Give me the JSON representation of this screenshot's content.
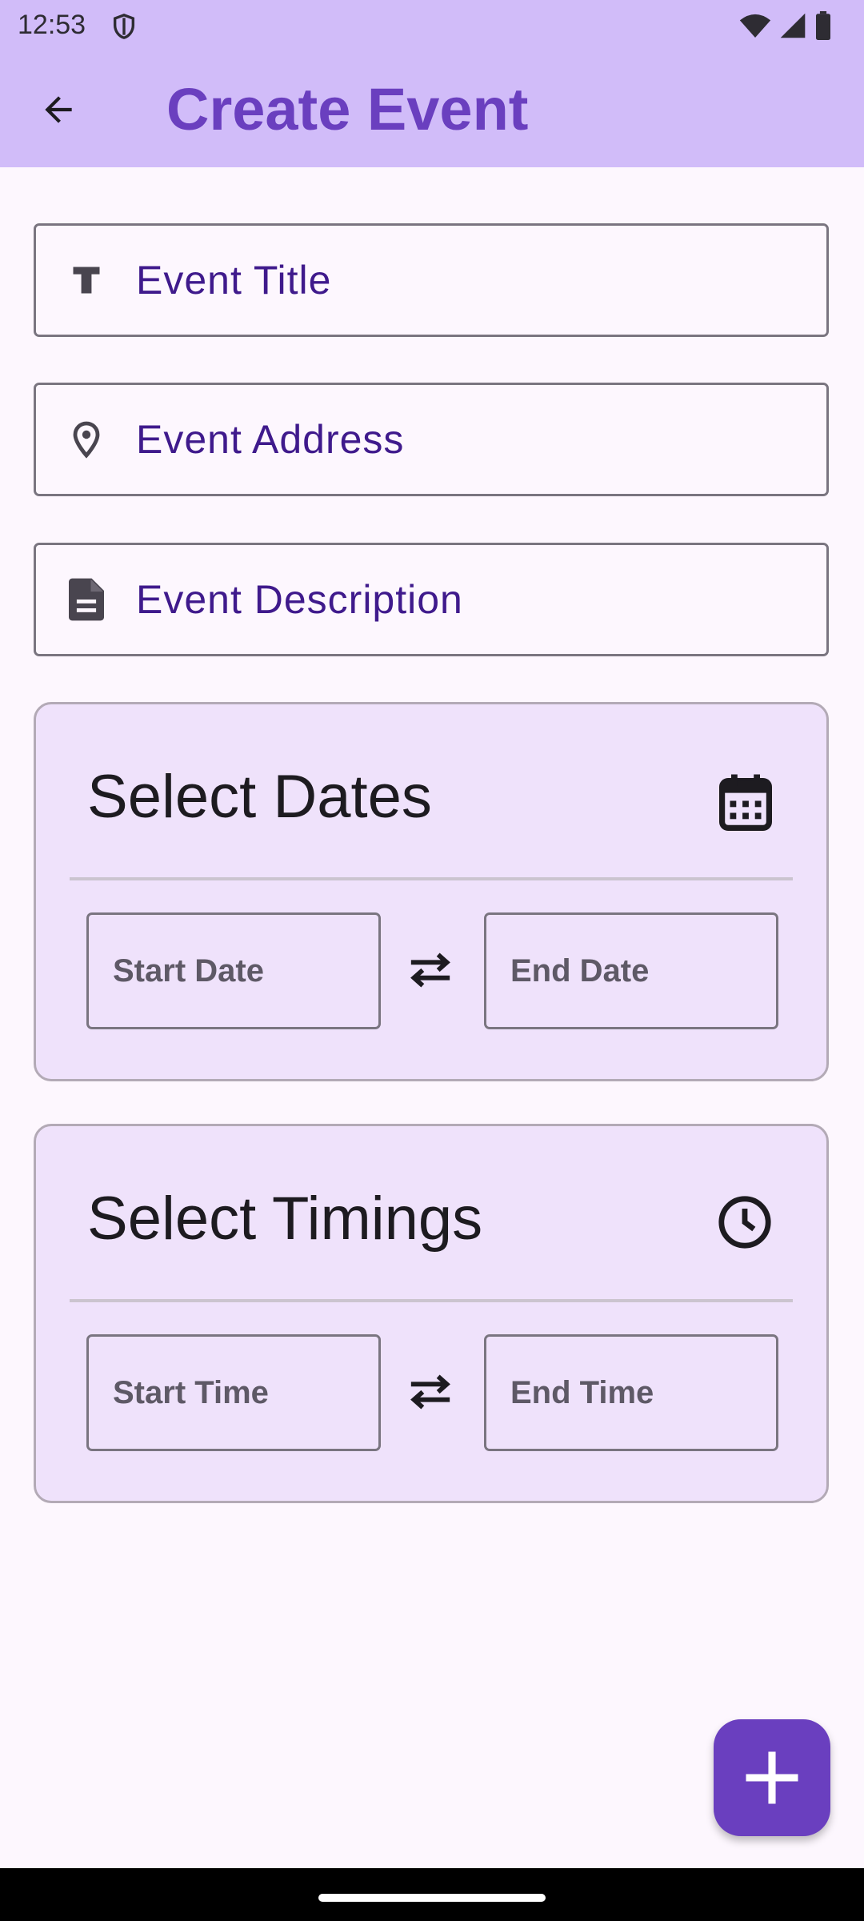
{
  "status_bar": {
    "time": "12:53"
  },
  "app_bar": {
    "title": "Create Event",
    "back_icon": "arrow-back-icon"
  },
  "fields": {
    "title": {
      "placeholder": "Event Title",
      "icon": "title-icon"
    },
    "address": {
      "placeholder": "Event Address",
      "icon": "location-pin-icon"
    },
    "description": {
      "placeholder": "Event Description",
      "icon": "document-icon"
    }
  },
  "dates_card": {
    "title": "Select Dates",
    "icon": "calendar-icon",
    "start_placeholder": "Start Date",
    "end_placeholder": "End Date"
  },
  "timings_card": {
    "title": "Select Timings",
    "icon": "clock-icon",
    "start_placeholder": "Start Time",
    "end_placeholder": "End Time"
  },
  "fab": {
    "icon": "add-icon"
  },
  "colors": {
    "app_bar": "#d1bcf9",
    "primary": "#6a3fbf",
    "field_text": "#3f1a8c",
    "card_background": "#efe2fb",
    "page_background": "#fdf7fe"
  }
}
